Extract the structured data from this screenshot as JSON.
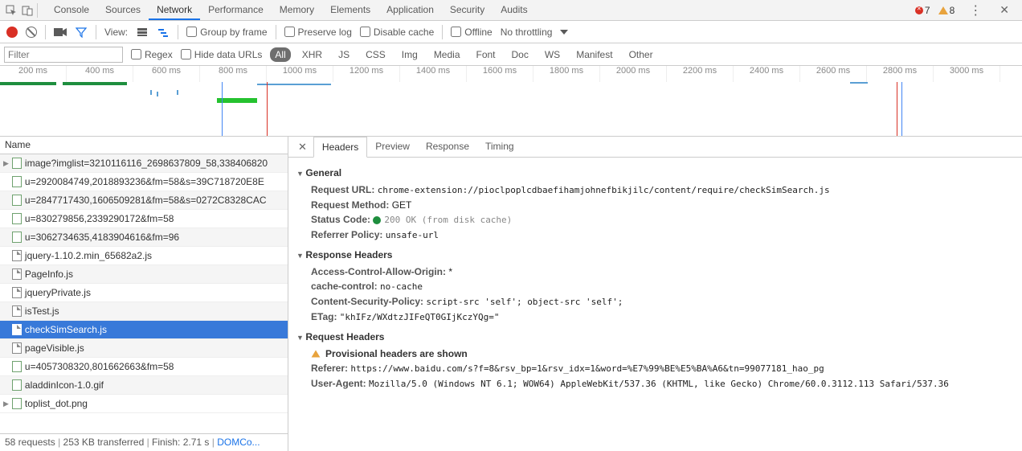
{
  "topbar": {
    "tabs": [
      "Console",
      "Sources",
      "Network",
      "Performance",
      "Memory",
      "Elements",
      "Application",
      "Security",
      "Audits"
    ],
    "active": "Network",
    "errors": 7,
    "warnings": 8
  },
  "toolbar": {
    "view_label": "View:",
    "group_by_frame": "Group by frame",
    "preserve_log": "Preserve log",
    "disable_cache": "Disable cache",
    "offline": "Offline",
    "no_throttling": "No throttling"
  },
  "filterbar": {
    "filter_placeholder": "Filter",
    "regex": "Regex",
    "hide_data": "Hide data URLs",
    "types": [
      "All",
      "XHR",
      "JS",
      "CSS",
      "Img",
      "Media",
      "Font",
      "Doc",
      "WS",
      "Manifest",
      "Other"
    ],
    "active_type": "All"
  },
  "timeline": {
    "ticks": [
      "200 ms",
      "400 ms",
      "600 ms",
      "800 ms",
      "1000 ms",
      "1200 ms",
      "1400 ms",
      "1600 ms",
      "1800 ms",
      "2000 ms",
      "2200 ms",
      "2400 ms",
      "2600 ms",
      "2800 ms",
      "3000 ms"
    ]
  },
  "left": {
    "header": "Name",
    "rows": [
      {
        "t": "image?imglist=3210116116_2698637809_58,338406820",
        "i": "img",
        "a": true
      },
      {
        "t": "u=2920084749,2018893236&fm=58&s=39C718720E8E",
        "i": "img",
        "a": false
      },
      {
        "t": "u=2847717430,1606509281&fm=58&s=0272C8328CAC",
        "i": "img",
        "a": false
      },
      {
        "t": "u=830279856,2339290172&fm=58",
        "i": "img",
        "a": false
      },
      {
        "t": "u=3062734635,4183904616&fm=96",
        "i": "img",
        "a": false
      },
      {
        "t": "jquery-1.10.2.min_65682a2.js",
        "i": "js",
        "a": false
      },
      {
        "t": "PageInfo.js",
        "i": "js",
        "a": false
      },
      {
        "t": "jqueryPrivate.js",
        "i": "js",
        "a": false
      },
      {
        "t": "isTest.js",
        "i": "js",
        "a": false
      },
      {
        "t": "checkSimSearch.js",
        "i": "js",
        "a": false,
        "sel": true
      },
      {
        "t": "pageVisible.js",
        "i": "js",
        "a": false
      },
      {
        "t": "u=4057308320,801662663&fm=58",
        "i": "img",
        "a": false
      },
      {
        "t": "aladdinIcon-1.0.gif",
        "i": "img",
        "a": false
      },
      {
        "t": "toplist_dot.png",
        "i": "img",
        "a": true
      }
    ]
  },
  "statusbar": {
    "requests": "58 requests",
    "transferred": "253 KB transferred",
    "finish": "Finish: 2.71 s",
    "domco": "DOMCo..."
  },
  "detail": {
    "tabs": [
      "Headers",
      "Preview",
      "Response",
      "Timing"
    ],
    "active": "Headers",
    "general_label": "General",
    "response_headers_label": "Response Headers",
    "request_headers_label": "Request Headers",
    "request_url_k": "Request URL:",
    "request_url_v": "chrome-extension://pioclpoplcdbaefihamjohnefbikjilc/content/require/checkSimSearch.js",
    "method_k": "Request Method:",
    "method_v": "GET",
    "status_k": "Status Code:",
    "status_v": "200 OK (from disk cache)",
    "refpol_k": "Referrer Policy:",
    "refpol_v": "unsafe-url",
    "acao_k": "Access-Control-Allow-Origin:",
    "acao_v": "*",
    "cc_k": "cache-control:",
    "cc_v": "no-cache",
    "csp_k": "Content-Security-Policy:",
    "csp_v": "script-src 'self'; object-src 'self';",
    "etag_k": "ETag:",
    "etag_v": "\"khIFz/WXdtzJIFeQT0GIjKczYQg=\"",
    "prov": "Provisional headers are shown",
    "referer_k": "Referer:",
    "referer_v": "https://www.baidu.com/s?f=8&rsv_bp=1&rsv_idx=1&word=%E7%99%BE%E5%BA%A6&tn=99077181_hao_pg",
    "ua_k": "User-Agent:",
    "ua_v": "Mozilla/5.0 (Windows NT 6.1; WOW64) AppleWebKit/537.36 (KHTML, like Gecko) Chrome/60.0.3112.113 Safari/537.36"
  }
}
